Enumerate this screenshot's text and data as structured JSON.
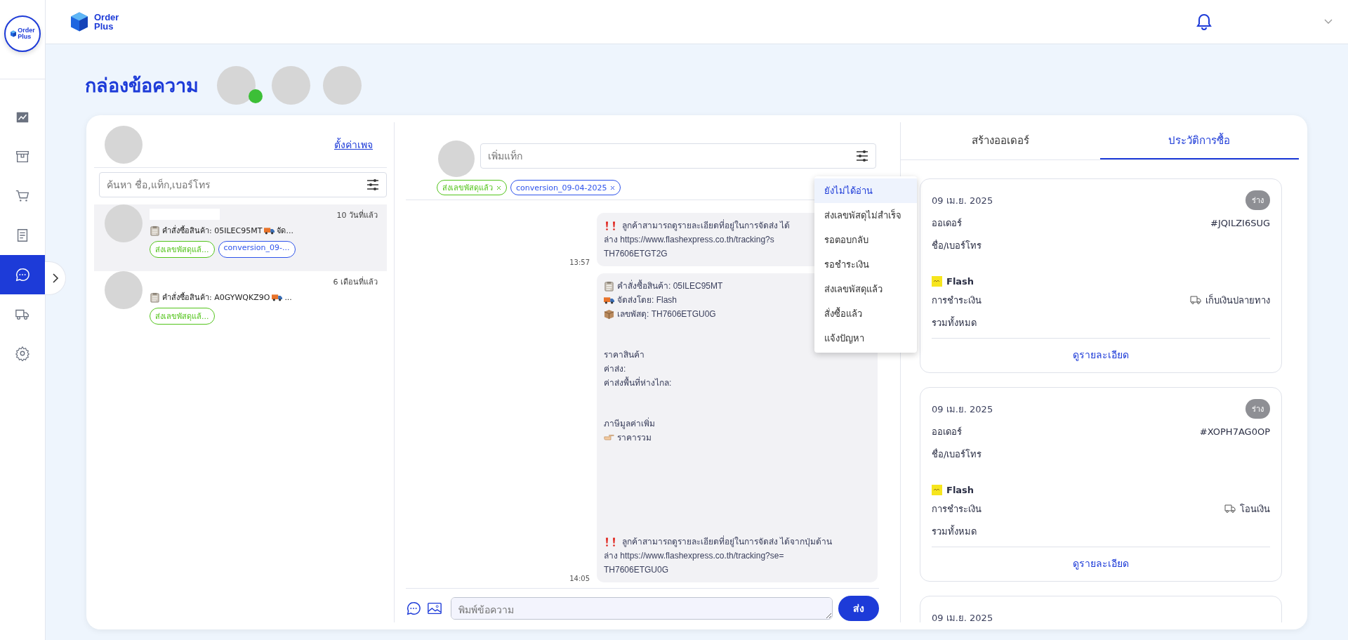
{
  "header": {
    "logo": [
      "Order",
      "Plus"
    ]
  },
  "sidebar": {
    "logo": [
      "Order",
      "Plus"
    ],
    "items": [
      {
        "selected": false
      },
      {
        "selected": false
      },
      {
        "selected": false
      },
      {
        "selected": false
      },
      {
        "selected": true
      },
      {
        "selected": false
      },
      {
        "selected": false
      }
    ]
  },
  "page_title": "กล่องข้อความ",
  "inbox": {
    "settings_link": "ตั้งค่าเพจ",
    "search": {
      "placeholder": "ค้นหา ชื่อ,แท็ก,เบอร์โทร"
    },
    "conversations": [
      {
        "selected": true,
        "time": "10 วันที่แล้ว",
        "preview": "คำสั่งซื้อสินค้า: 05ILEC95MT",
        "preview_tail": "จัด...",
        "tags": [
          {
            "label": "ส่งเลขพัสดุแล้...",
            "color": "#52c41a"
          },
          {
            "label": "conversion_09-...",
            "color": "#2f54eb"
          }
        ]
      },
      {
        "selected": false,
        "time": "6 เดือนที่แล้ว",
        "preview": "คำสั่งซื้อสินค้า: A0GYWQKZ9O",
        "preview_tail": "...",
        "tags": [
          {
            "label": "ส่งเลขพัสดุแล้...",
            "color": "#52c41a"
          }
        ]
      }
    ]
  },
  "chat": {
    "tag_input": {
      "placeholder": "เพิ่มแท็ก"
    },
    "tags": [
      {
        "label": "ส่งเลขพัสดุแล้ว",
        "color": "#52c41a"
      },
      {
        "label": "conversion_09-04-2025",
        "color": "#2f54eb"
      }
    ],
    "messages": [
      {
        "time": "13:57",
        "blocks": [
          [
            {
              "kind": "alert",
              "text": "ลูกค้าสามารถดูรายละเอียดที่อยู่ในการจัดส่ง ได้"
            },
            {
              "kind": "plain",
              "text": "ล่าง  https://www.flashexpress.co.th/tracking?s"
            },
            {
              "kind": "plain",
              "text": "TH7606ETGT2G"
            }
          ]
        ]
      },
      {
        "time": "14:05",
        "blocks": [
          [
            {
              "kind": "clipboard",
              "text": "คำสั่งซื้อสินค้า: 05ILEC95MT"
            },
            {
              "kind": "truck",
              "text": "จัดส่งโดย: Flash"
            },
            {
              "kind": "parcel",
              "text": "เลขพัสดุ: TH7606ETGU0G"
            }
          ],
          [
            {
              "kind": "plain",
              "text": "ราคาสินค้า"
            },
            {
              "kind": "plain",
              "text": "ค่าส่ง:"
            },
            {
              "kind": "plain",
              "text": "ค่าส่งพื้นที่ห่างไกล:"
            }
          ],
          [
            {
              "kind": "plain",
              "text": "ภาษีมูลค่าเพิ่ม"
            },
            {
              "kind": "pointer",
              "text": "ราคารวม"
            }
          ],
          [
            {
              "kind": "alert",
              "text": "ลูกค้าสามารถดูรายละเอียดที่อยู่ในการจัดส่ง ได้จากปุ่มด้าน"
            },
            {
              "kind": "plain",
              "text": "ล่าง  https://www.flashexpress.co.th/tracking?se="
            },
            {
              "kind": "plain",
              "text": "TH7606ETGU0G"
            }
          ]
        ]
      }
    ],
    "status_menu": [
      {
        "label": "ยังไม่ได้อ่าน",
        "selected": true
      },
      {
        "label": "ส่งเลขพัสดุไม่สำเร็จ",
        "selected": false
      },
      {
        "label": "รอตอบกลับ",
        "selected": false
      },
      {
        "label": "รอชำระเงิน",
        "selected": false
      },
      {
        "label": "ส่งเลขพัสดุแล้ว",
        "selected": false
      },
      {
        "label": "สั่งซื้อแล้ว",
        "selected": false
      },
      {
        "label": "แจ้งปัญหา",
        "selected": false
      }
    ],
    "composer": {
      "placeholder": "พิมพ์ข้อความ",
      "send": "ส่ง"
    }
  },
  "orders": {
    "tabs": [
      {
        "label": "สร้างออเดอร์",
        "selected": false
      },
      {
        "label": "ประวัติการซื้อ",
        "selected": true
      }
    ],
    "cards": [
      {
        "date": "09 เม.ย. 2025",
        "status": "ร่าง",
        "order_label": "ออเดอร์",
        "order_id": "#JQILZI6SUG",
        "name_label": "ชื่อ/เบอร์โทร",
        "carrier": "Flash",
        "payment_label": "การชำระเงิน",
        "payment": "เก็บเงินปลายทาง",
        "total_label": "รวมทั้งหมด",
        "details_link": "ดูรายละเอียด"
      },
      {
        "date": "09 เม.ย. 2025",
        "status": "ร่าง",
        "order_label": "ออเดอร์",
        "order_id": "#XOPH7AG0OP",
        "name_label": "ชื่อ/เบอร์โทร",
        "carrier": "Flash",
        "payment_label": "การชำระเงิน",
        "payment": "โอนเงิน",
        "total_label": "รวมทั้งหมด",
        "details_link": "ดูรายละเอียด"
      },
      {
        "date": "09 เม.ย. 2025"
      }
    ]
  }
}
